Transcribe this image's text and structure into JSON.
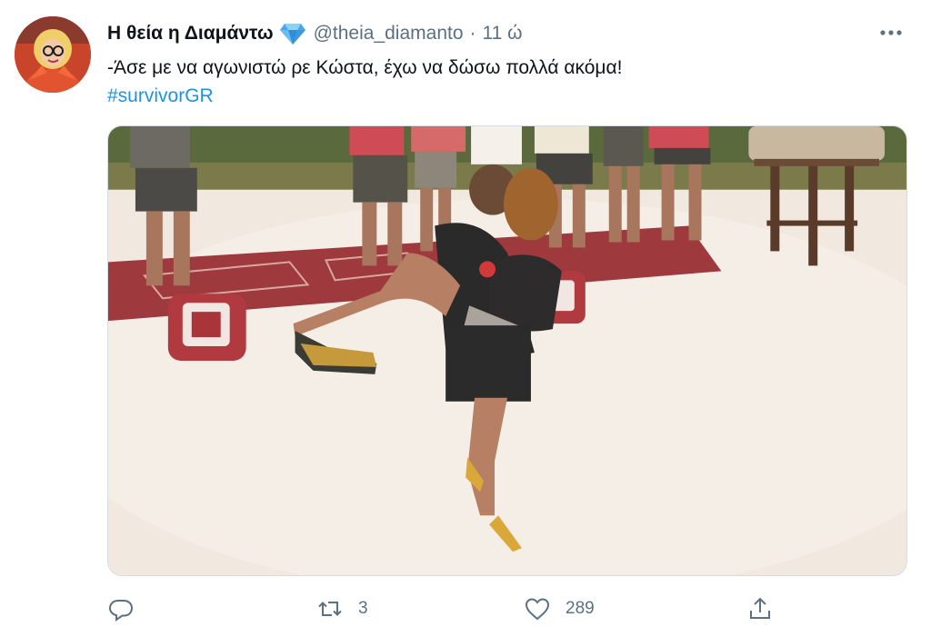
{
  "author": {
    "display_name": "Η θεία η Διαμάντω",
    "verified_icon": "diamond-icon",
    "handle": "@theia_diamanto",
    "separator": "·",
    "time": "11 ώ"
  },
  "tweet": {
    "text": "-Άσε με να αγωνιστώ ρε Κώστα, έχω να δώσω πολλά ακόμα!",
    "hashtag": "#survivorGR"
  },
  "media": {
    "kind": "video-still",
    "icon": "image-icon"
  },
  "actions": {
    "reply": {
      "icon": "reply-icon",
      "count": ""
    },
    "retweet": {
      "icon": "retweet-icon",
      "count": "3"
    },
    "like": {
      "icon": "heart-icon",
      "count": "289"
    },
    "share": {
      "icon": "share-icon",
      "count": ""
    }
  },
  "menu": {
    "icon": "more-icon",
    "label": "···"
  },
  "colors": {
    "text": "#0f1419",
    "muted": "#5b7083",
    "link": "#1b95e0",
    "verified": "#4aa8e8",
    "sand": "#f2e9e1",
    "mat": "#9e3a3e"
  }
}
